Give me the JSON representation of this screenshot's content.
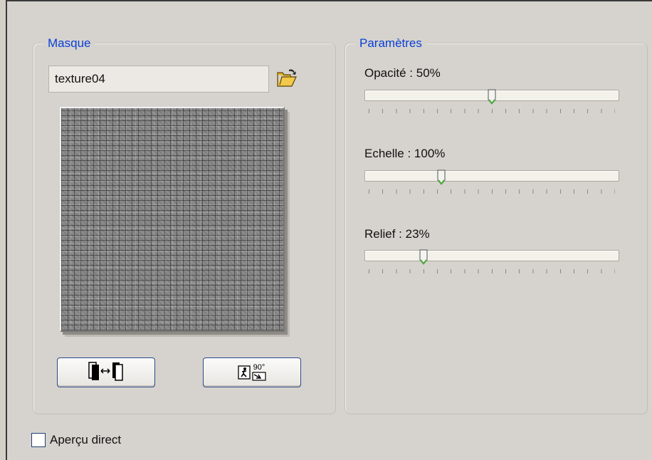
{
  "mask": {
    "title": "Masque",
    "name_value": "texture04",
    "open_icon": "folder-open-icon",
    "buttons": [
      {
        "icon": "invert-mask-icon"
      },
      {
        "icon": "rotate-90-icon",
        "text": "90°"
      }
    ]
  },
  "params": {
    "title": "Paramètres",
    "sliders": [
      {
        "label": "Opacité : 50%",
        "value_percent": 50
      },
      {
        "label": "Echelle : 100%",
        "value_percent": 30
      },
      {
        "label": "Relief : 23%",
        "value_percent": 23
      }
    ]
  },
  "live_preview": {
    "label": "Aperçu direct",
    "checked": false
  },
  "colors": {
    "accent": "#0a3fd6",
    "thumb_green": "#4caf3a"
  }
}
